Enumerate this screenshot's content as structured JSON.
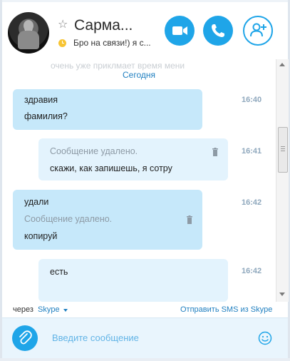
{
  "header": {
    "contact_name": "Сарма...",
    "mood_message": "Бро на связи!) я с...",
    "favorite_icon": "star-outline-icon",
    "status_icon": "away-clock-icon",
    "video_call_icon": "video-camera-icon",
    "audio_call_icon": "phone-icon",
    "add_people_icon": "add-person-icon",
    "accent_color": "#1fa5e8"
  },
  "chat": {
    "partial_text": "очень уже приклмает время мени",
    "date_label": "Сегодня",
    "messages": [
      {
        "direction": "incoming",
        "lines": [
          "здравия",
          "фамилия?"
        ],
        "time": "16:40"
      },
      {
        "direction": "outgoing",
        "deleted_text": "Сообщение удалено.",
        "lines": [
          "скажи, как запишешь, я сотру"
        ],
        "time": "16:41"
      },
      {
        "direction": "incoming",
        "lines": [
          "удали"
        ],
        "deleted_text": "Сообщение удалено.",
        "lines_after": [
          "копируй"
        ],
        "time": "16:42"
      },
      {
        "direction": "outgoing",
        "lines": [
          "есть"
        ],
        "time": "16:42"
      }
    ]
  },
  "footer": {
    "via_label": "через",
    "via_service": "Skype",
    "sms_link": "Отправить SMS из Skype"
  },
  "composer": {
    "placeholder": "Введите сообщение",
    "value": "",
    "attach_icon": "paperclip-icon",
    "emoji_icon": "smiley-icon"
  }
}
